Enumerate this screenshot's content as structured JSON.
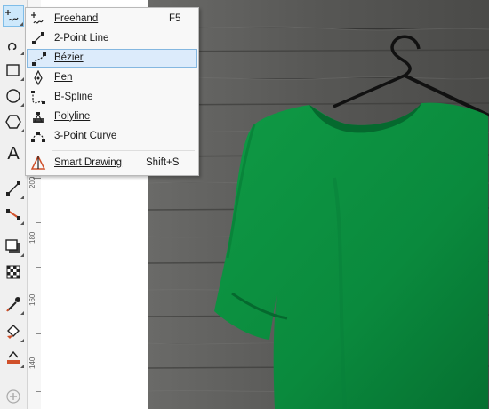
{
  "toolbox": {
    "tools": [
      {
        "name": "freehand-tool-icon",
        "active": true
      },
      {
        "name": "artistic-media-icon"
      },
      {
        "name": "rectangle-icon"
      },
      {
        "name": "ellipse-icon"
      },
      {
        "name": "polygon-icon"
      },
      {
        "name": "text-icon",
        "label": "A"
      },
      {
        "name": "parallel-dimension-icon"
      },
      {
        "name": "connector-icon"
      },
      {
        "name": "drop-shadow-icon"
      },
      {
        "name": "transparency-icon"
      },
      {
        "name": "eyedropper-icon"
      },
      {
        "name": "interactive-fill-icon"
      },
      {
        "name": "smart-fill-icon"
      },
      {
        "name": "add-tool-icon"
      }
    ]
  },
  "ruler": {
    "labels": [
      "200",
      "180",
      "160",
      "140"
    ]
  },
  "flyout": {
    "items": [
      {
        "label": "Freehand",
        "mnemonic": "F",
        "shortcut": "F5",
        "icon": "freehand-icon"
      },
      {
        "label": "2-Point Line",
        "mnemonic": "",
        "shortcut": "",
        "icon": "two-point-line-icon"
      },
      {
        "label": "Bézier",
        "mnemonic": "B",
        "shortcut": "",
        "icon": "bezier-icon",
        "highlighted": true
      },
      {
        "label": "Pen",
        "mnemonic": "P",
        "shortcut": "",
        "icon": "pen-icon"
      },
      {
        "label": "B-Spline",
        "mnemonic": "",
        "shortcut": "",
        "icon": "b-spline-icon"
      },
      {
        "label": "Polyline",
        "mnemonic": "P",
        "shortcut": "",
        "icon": "polyline-icon"
      },
      {
        "label": "3-Point Curve",
        "mnemonic": "3",
        "shortcut": "",
        "icon": "three-point-curve-icon"
      },
      {
        "label": "Smart Drawing",
        "mnemonic": "S",
        "shortcut": "Shift+S",
        "icon": "smart-drawing-icon"
      }
    ]
  },
  "photo": {
    "shirt_color": "#0b8a3e",
    "wall_color": "#5e5e5c",
    "hanger_color": "#111111"
  }
}
